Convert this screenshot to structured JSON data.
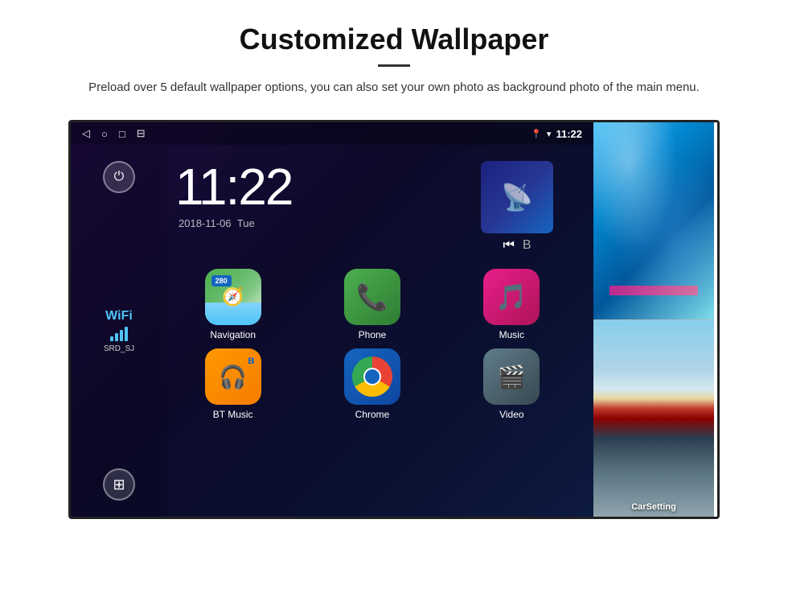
{
  "header": {
    "title": "Customized Wallpaper",
    "description": "Preload over 5 default wallpaper options, you can also set your own photo as background photo of the main menu."
  },
  "status_bar": {
    "time": "11:22",
    "nav_icons": [
      "◁",
      "○",
      "□",
      "⊞"
    ],
    "right_icons": [
      "📍",
      "▾"
    ]
  },
  "clock": {
    "time": "11:22",
    "date": "2018-11-06",
    "day": "Tue"
  },
  "wifi": {
    "label": "WiFi",
    "ssid": "SRD_SJ"
  },
  "apps": [
    {
      "name": "Navigation",
      "icon_type": "navigation"
    },
    {
      "name": "Phone",
      "icon_type": "phone"
    },
    {
      "name": "Music",
      "icon_type": "music"
    },
    {
      "name": "BT Music",
      "icon_type": "bt_music"
    },
    {
      "name": "Chrome",
      "icon_type": "chrome"
    },
    {
      "name": "Video",
      "icon_type": "video"
    }
  ],
  "sidebar": {
    "power_icon": "⏻",
    "apps_icon": "⊞",
    "wifi_bars": [
      6,
      10,
      14,
      18
    ]
  },
  "nav_badge": "280",
  "carsetting_label": "CarSetting"
}
